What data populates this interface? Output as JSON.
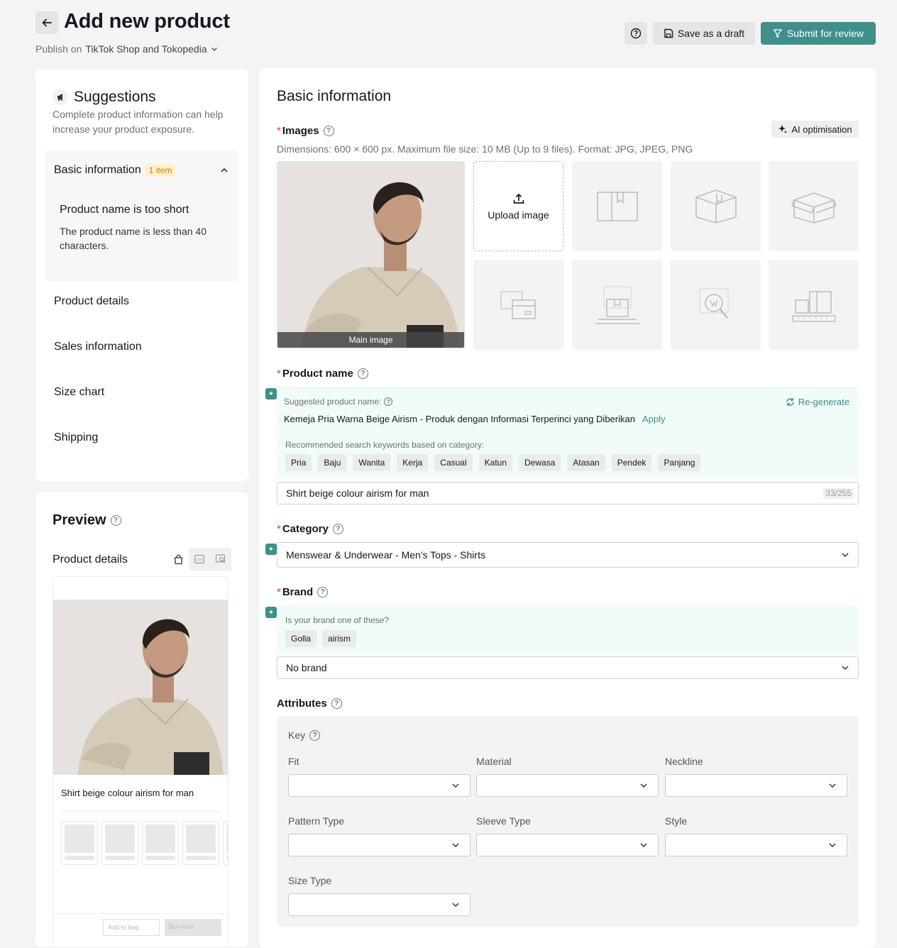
{
  "header": {
    "title": "Add new product",
    "publish_prefix": "Publish on",
    "publish_target": "TikTok Shop and Tokopedia",
    "save_draft_label": "Save as a draft",
    "submit_label": "Submit for review"
  },
  "colors": {
    "accent": "#3f8f8b",
    "required": "#e43c3c",
    "badge_bg": "#fdf0cc",
    "ai_bg": "#f1fbf9"
  },
  "suggestions": {
    "title": "Suggestions",
    "description": "Complete product information can help increase your product exposure.",
    "section": {
      "label": "Basic information",
      "badge": "1 item"
    },
    "issue": {
      "title": "Product name is too short",
      "description": "The product name is less than 40 characters."
    },
    "nav": [
      "Product details",
      "Sales information",
      "Size chart",
      "Shipping"
    ]
  },
  "preview": {
    "title": "Preview",
    "subtitle": "Product details",
    "product_name": "Shirt beige colour airism for man",
    "add_to_bag": "Add to bag",
    "buy_now": "Buy now"
  },
  "basic": {
    "title": "Basic information",
    "images": {
      "label": "Images",
      "ai_button": "AI optimisation",
      "dimensions": "Dimensions: 600 × 600 px. Maximum file size: 10 MB (Up to 9 files). Format: JPG, JPEG, PNG",
      "main_caption": "Main image",
      "upload_label": "Upload image"
    },
    "product_name": {
      "label": "Product name",
      "suggested_label": "Suggested product name:",
      "suggested_value": "Kemeja Pria Warna Beige Airism - Produk dengan Informasi Terperinci yang Diberikan",
      "apply_label": "Apply",
      "regenerate_label": "Re-generate",
      "keywords_label": "Recommended search keywords based on category:",
      "keywords": [
        "Pria",
        "Baju",
        "Wanita",
        "Kerja",
        "Casual",
        "Katun",
        "Dewasa",
        "Atasan",
        "Pendek",
        "Panjang"
      ],
      "value": "Shirt beige colour airism for man",
      "counter": "33/255"
    },
    "category": {
      "label": "Category",
      "value": "Menswear & Underwear - Men's Tops - Shirts"
    },
    "brand": {
      "label": "Brand",
      "question": "Is your brand one of these?",
      "options": [
        "Golla",
        "airism"
      ],
      "value": "No brand"
    },
    "attributes": {
      "label": "Attributes",
      "key_label": "Key",
      "fields": [
        "Fit",
        "Material",
        "Neckline",
        "Pattern Type",
        "Sleeve Type",
        "Style",
        "Size Type"
      ]
    }
  }
}
